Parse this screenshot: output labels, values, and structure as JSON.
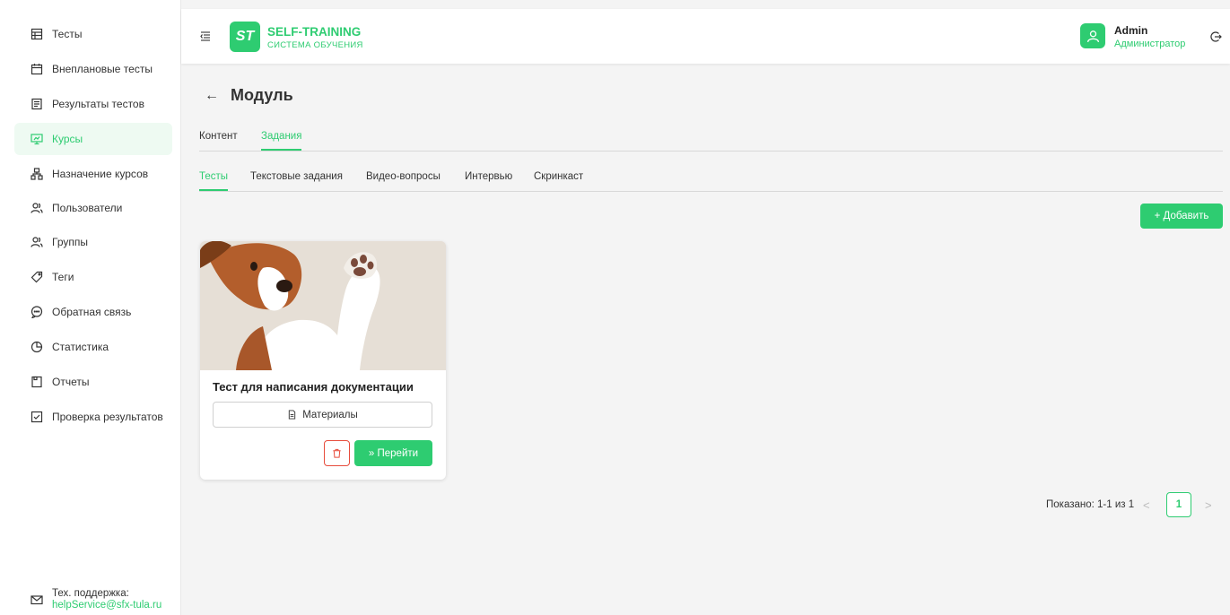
{
  "sidebar": {
    "items": [
      {
        "label": "Тесты",
        "icon": "test-icon"
      },
      {
        "label": "Внеплановые тесты",
        "icon": "calendar-icon"
      },
      {
        "label": "Результаты тестов",
        "icon": "results-icon"
      },
      {
        "label": "Курсы",
        "icon": "course-icon"
      },
      {
        "label": "Назначение курсов",
        "icon": "hierarchy-icon"
      },
      {
        "label": "Пользователи",
        "icon": "users-icon"
      },
      {
        "label": "Группы",
        "icon": "groups-icon"
      },
      {
        "label": "Теги",
        "icon": "tag-icon"
      },
      {
        "label": "Обратная связь",
        "icon": "feedback-icon"
      },
      {
        "label": "Статистика",
        "icon": "pie-chart-icon"
      },
      {
        "label": "Отчеты",
        "icon": "report-icon"
      },
      {
        "label": "Проверка результатов",
        "icon": "checkbox-icon"
      }
    ],
    "active_index": 3,
    "support_label": "Тех. поддержка:",
    "support_email": "helpService@sfx-tula.ru"
  },
  "header": {
    "logo_text": "ST",
    "brand_title": "SELF-TRAINING",
    "brand_subtitle": "СИСТЕМА ОБУЧЕНИЯ",
    "user_name": "Admin",
    "user_role": "Администратор"
  },
  "main": {
    "back_symbol": "←",
    "title": "Модуль",
    "tabs": [
      {
        "label": "Контент",
        "active": false
      },
      {
        "label": "Задания",
        "active": true
      }
    ],
    "subtabs": [
      {
        "label": "Тесты",
        "active": true
      },
      {
        "label": "Текстовые задания",
        "active": false
      },
      {
        "label": "Видео-вопросы",
        "active": false
      },
      {
        "label": "Интервью",
        "active": false
      },
      {
        "label": "Скринкаст",
        "active": false
      }
    ],
    "add_button": "+ Добавить",
    "card": {
      "title": "Тест для написания документации",
      "materials_label": "Материалы",
      "go_label": "» Перейти"
    },
    "pagination": {
      "text": "Показано: 1-1 из 1",
      "current_page": "1",
      "prev": "<",
      "next": ">"
    }
  },
  "colors": {
    "accent": "#2ecc71",
    "danger": "#e74c3c"
  }
}
